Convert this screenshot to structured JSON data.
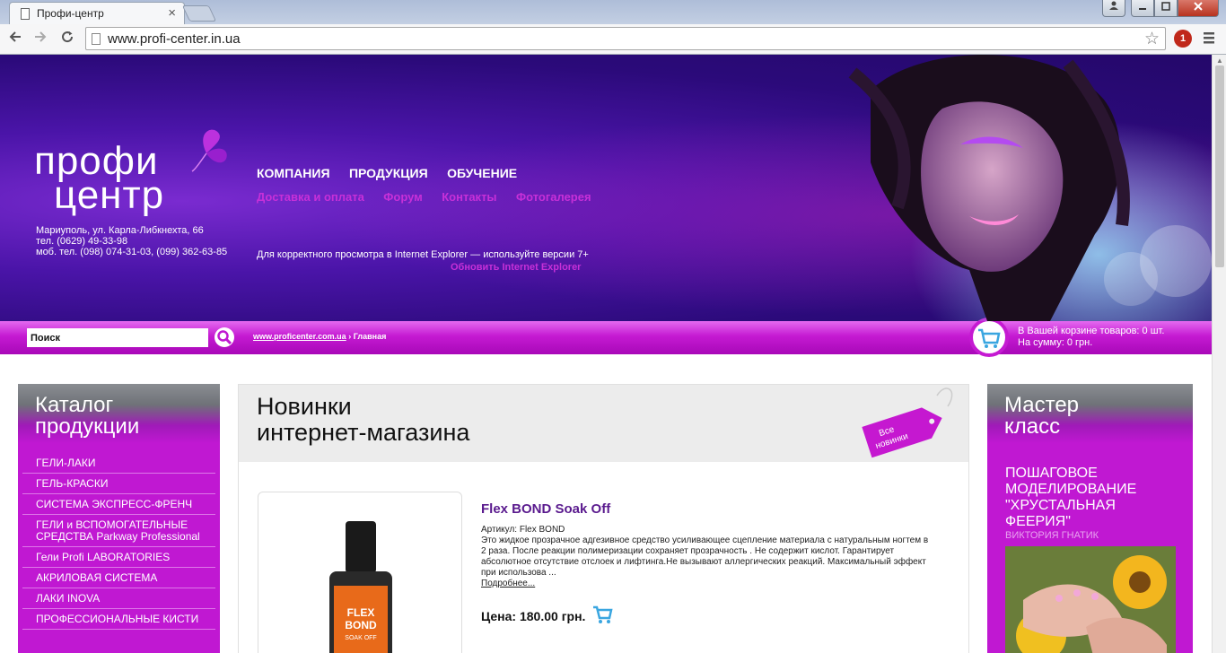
{
  "browser": {
    "tab_title": "Профи-центр",
    "tab_close": "×",
    "url": "www.profi-center.in.ua",
    "ext_badge": "1"
  },
  "header": {
    "logo_line1": "профи",
    "logo_line2": "центр",
    "address": "Мариуполь, ул. Карла-Либкнехта, 66",
    "phone": "тел. (0629) 49-33-98",
    "mobile": "моб. тел. (098) 074-31-03, (099) 362-63-85",
    "main_nav": [
      "КОМПАНИЯ",
      "ПРОДУКЦИЯ",
      "ОБУЧЕНИЕ"
    ],
    "sub_nav": [
      "Доставка и оплата",
      "Форум",
      "Контакты",
      "Фотогалерея"
    ],
    "ie_note": "Для корректного просмотра в Internet Explorer — используйте версии 7+",
    "ie_link": "Обновить Internet Explorer"
  },
  "bar": {
    "search_value": "Поиск",
    "breadcrumb_link": "www.proficenter.com.ua",
    "breadcrumb_sep": "›",
    "breadcrumb_current": "Главная",
    "cart_items": "В Вашей корзине товаров: 0 шт.",
    "cart_sum": "На сумму: 0 грн."
  },
  "catalog": {
    "title_line1": "Каталог",
    "title_line2": "продукции",
    "items": [
      "ГЕЛИ-ЛАКИ",
      "ГЕЛЬ-КРАСКИ",
      "СИСТЕМА ЭКСПРЕСС-ФРЕНЧ",
      "ГЕЛИ и ВСПОМОГАТЕЛЬНЫЕ СРЕДСТВА Parkway Professional",
      "Гели Profi LABORATORIES",
      "АКРИЛОВАЯ СИСТЕМА",
      "ЛАКИ INOVA",
      "ПРОФЕССИОНАЛЬНЫЕ КИСТИ"
    ]
  },
  "new_items": {
    "title_line1": "Новинки",
    "title_line2": "интернет-магазина",
    "tag_line1": "Все",
    "tag_line2": "новинки",
    "product": {
      "bottle_line1": "FLEX",
      "bottle_line2": "BOND",
      "bottle_line3": "SOAK OFF",
      "name": "Flex BOND Soak Off",
      "sku": "Артикул: Flex BOND",
      "description": "Это жидкое прозрачное адгезивное средство усиливающее сцепление материала с натуральным ногтем в 2 раза. После реакции полимеризации сохраняет прозрачность . Не содержит кислот. Гарантирует абсолютное отсутствие отслоек и лифтинга.Не вызывают аллергических реакций. Максимальный эффект при использова ...",
      "more": "Подробнее...",
      "price": "Цена: 180.00 грн."
    }
  },
  "master_class": {
    "title_line1": "Мастер",
    "title_line2": "класс",
    "course": "ПОШАГОВОЕ МОДЕЛИРОВАНИЕ \"ХРУСТАЛЬНАЯ ФЕЕРИЯ\"",
    "author": "ВИКТОРИЯ ГНАТИК"
  },
  "colors": {
    "brand_magenta": "#c018d2",
    "header_violet": "#4a14a8",
    "link_pink": "#c730d8",
    "product_title": "#5a1a8e"
  },
  "icons": [
    "search-icon",
    "cart-icon",
    "star-icon",
    "reload-icon",
    "back-icon",
    "forward-icon",
    "butterfly-icon",
    "menu-icon"
  ]
}
